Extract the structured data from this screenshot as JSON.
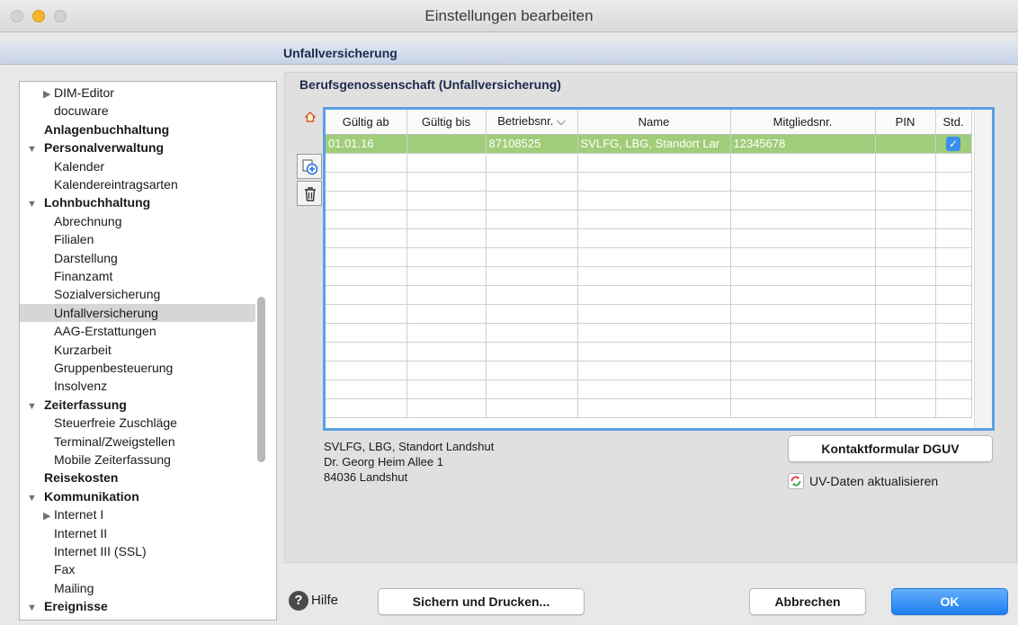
{
  "window": {
    "title": "Einstellungen bearbeiten"
  },
  "section": {
    "title": "Unfallversicherung"
  },
  "tree": [
    {
      "label": "DIM-Editor",
      "indent": 1,
      "arrow": "▶",
      "bold": false
    },
    {
      "label": "docuware",
      "indent": 1,
      "arrow": "",
      "bold": false
    },
    {
      "label": "Anlagenbuchhaltung",
      "indent": 0,
      "arrow": "",
      "bold": true
    },
    {
      "label": "Personalverwaltung",
      "indent": 0,
      "arrow": "▼",
      "bold": true
    },
    {
      "label": "Kalender",
      "indent": 1,
      "arrow": "",
      "bold": false
    },
    {
      "label": "Kalendereintragsarten",
      "indent": 1,
      "arrow": "",
      "bold": false
    },
    {
      "label": "Lohnbuchhaltung",
      "indent": 0,
      "arrow": "▼",
      "bold": true
    },
    {
      "label": "Abrechnung",
      "indent": 1,
      "arrow": "",
      "bold": false
    },
    {
      "label": "Filialen",
      "indent": 1,
      "arrow": "",
      "bold": false
    },
    {
      "label": "Darstellung",
      "indent": 1,
      "arrow": "",
      "bold": false
    },
    {
      "label": "Finanzamt",
      "indent": 1,
      "arrow": "",
      "bold": false
    },
    {
      "label": "Sozialversicherung",
      "indent": 1,
      "arrow": "",
      "bold": false
    },
    {
      "label": "Unfallversicherung",
      "indent": 1,
      "arrow": "",
      "bold": false,
      "selected": true
    },
    {
      "label": "AAG-Erstattungen",
      "indent": 1,
      "arrow": "",
      "bold": false
    },
    {
      "label": "Kurzarbeit",
      "indent": 1,
      "arrow": "",
      "bold": false
    },
    {
      "label": "Gruppenbesteuerung",
      "indent": 1,
      "arrow": "",
      "bold": false
    },
    {
      "label": "Insolvenz",
      "indent": 1,
      "arrow": "",
      "bold": false
    },
    {
      "label": "Zeiterfassung",
      "indent": 0,
      "arrow": "▼",
      "bold": true
    },
    {
      "label": "Steuerfreie Zuschläge",
      "indent": 1,
      "arrow": "",
      "bold": false
    },
    {
      "label": "Terminal/Zweigstellen",
      "indent": 1,
      "arrow": "",
      "bold": false
    },
    {
      "label": "Mobile Zeiterfassung",
      "indent": 1,
      "arrow": "",
      "bold": false
    },
    {
      "label": "Reisekosten",
      "indent": 0,
      "arrow": "",
      "bold": true
    },
    {
      "label": "Kommunikation",
      "indent": 0,
      "arrow": "▼",
      "bold": true
    },
    {
      "label": "Internet I",
      "indent": 1,
      "arrow": "▶",
      "bold": false
    },
    {
      "label": "Internet II",
      "indent": 1,
      "arrow": "",
      "bold": false
    },
    {
      "label": "Internet III (SSL)",
      "indent": 1,
      "arrow": "",
      "bold": false
    },
    {
      "label": "Fax",
      "indent": 1,
      "arrow": "",
      "bold": false
    },
    {
      "label": "Mailing",
      "indent": 1,
      "arrow": "",
      "bold": false
    },
    {
      "label": "Ereignisse",
      "indent": 0,
      "arrow": "▼",
      "bold": true
    }
  ],
  "group": {
    "title": "Berufsgenossenschaft (Unfallversicherung)"
  },
  "table": {
    "columns": [
      "Gültig ab",
      "Gültig bis",
      "Betriebsnr. ⌵",
      "Name",
      "Mitgliedsnr.",
      "PIN",
      "Std."
    ],
    "rows": [
      {
        "gueltig_ab": "01.01.16",
        "gueltig_bis": "",
        "betriebsnr": "87108525",
        "name": "SVLFG, LBG, Standort Lar",
        "mitgliedsnr": "12345678",
        "pin": "",
        "std": "✓"
      }
    ]
  },
  "address": {
    "line1": "SVLFG, LBG, Standort Landshut",
    "line2": "Dr. Georg Heim Allee 1",
    "line3": "84036 Landshut"
  },
  "buttons": {
    "dguv": "Kontaktformular DGUV",
    "refresh": "UV-Daten aktualisieren",
    "help": "Hilfe",
    "print": "Sichern und Drucken...",
    "cancel": "Abbrechen",
    "ok": "OK"
  },
  "colors": {
    "accent": "#1d7ef0",
    "row_highlight": "#a0cd79",
    "table_border": "#5aa0e6"
  }
}
